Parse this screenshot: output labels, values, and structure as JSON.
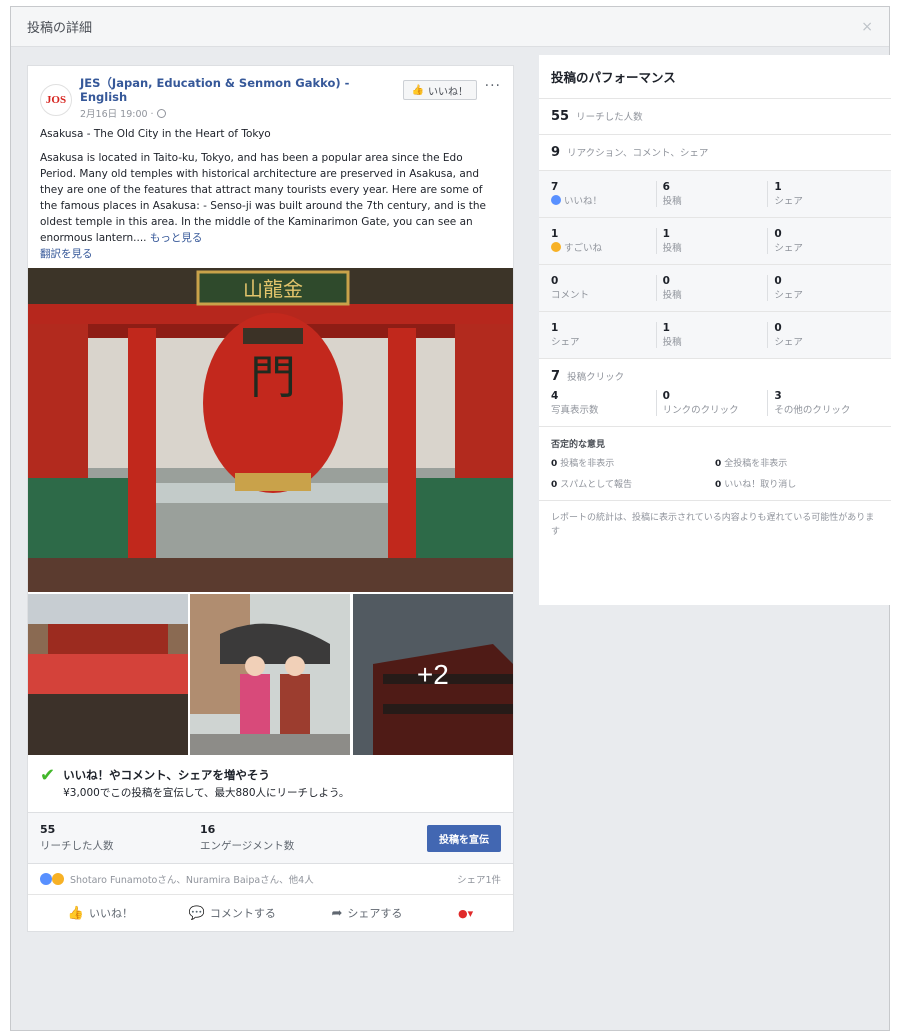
{
  "modal": {
    "title": "投稿の詳細",
    "close": "×"
  },
  "post": {
    "logo": "JOS",
    "page_name": "JES（Japan, Education & Senmon Gakko) - English",
    "time": "2月16日 19:00 ·",
    "like_page": "いいね！",
    "more": "···",
    "headline": "Asakusa - The Old City in the Heart of Tokyo",
    "body": "Asakusa is located in Taito-ku, Tokyo, and has been a popular area since the Edo Period. Many old temples with historical architecture are preserved in Asakusa, and they are one of the features that attract many tourists every year. Here are some of the famous places in Asakusa: - Senso-ji was built around the 7th century, and is the oldest temple in this area. In the middle of the Kaminarimon Gate, you can see an enormous lantern....",
    "see_more": "もっと見る",
    "translate": "翻訳を見る",
    "gate_sign": "山龍金",
    "more_photos": "+2"
  },
  "boost_tip": {
    "title": "いいね！やコメント、シェアを増やそう",
    "subtitle": "¥3,000でこの投稿を宣伝して、最大880人にリーチしよう。"
  },
  "stats": {
    "reach_num": "55",
    "reach_label": "リーチした人数",
    "engagement_num": "16",
    "engagement_label": "エンゲージメント数",
    "boost_button": "投稿を宣伝"
  },
  "reactions": {
    "names": "Shotaro Funamotoさん、Nuramira Baipaさん、他4人",
    "shares": "シェア1件"
  },
  "actions": {
    "like": "いいね！",
    "comment": "コメントする",
    "share": "シェアする"
  },
  "performance": {
    "title": "投稿のパフォーマンス",
    "reach_num": "55",
    "reach_label": "リーチした人数",
    "reactions_num": "9",
    "reactions_label": "リアクション、コメント、シェア",
    "rows": [
      [
        {
          "num": "7",
          "label": "いいね！"
        },
        {
          "num": "6",
          "label": "投稿"
        },
        {
          "num": "1",
          "label": "シェア"
        }
      ],
      [
        {
          "num": "1",
          "label": "すごいね"
        },
        {
          "num": "1",
          "label": "投稿"
        },
        {
          "num": "0",
          "label": "シェア"
        }
      ],
      [
        {
          "num": "0",
          "label": "コメント"
        },
        {
          "num": "0",
          "label": "投稿"
        },
        {
          "num": "0",
          "label": "シェア"
        }
      ],
      [
        {
          "num": "1",
          "label": "シェア"
        },
        {
          "num": "1",
          "label": "投稿"
        },
        {
          "num": "0",
          "label": "シェア"
        }
      ]
    ],
    "clicks_num": "7",
    "clicks_label": "投稿クリック",
    "clicks": [
      {
        "num": "4",
        "label": "写真表示数"
      },
      {
        "num": "0",
        "label": "リンクのクリック"
      },
      {
        "num": "3",
        "label": "その他のクリック"
      }
    ],
    "negative_title": "否定的な意見",
    "negative": [
      {
        "num": "0",
        "label": "投稿を非表示"
      },
      {
        "num": "0",
        "label": "全投稿を非表示"
      },
      {
        "num": "0",
        "label": "スパムとして報告"
      },
      {
        "num": "0",
        "label": "いいね！取り消し"
      }
    ],
    "footnote": "レポートの統計は、投稿に表示されている内容よりも遅れている可能性があります"
  }
}
